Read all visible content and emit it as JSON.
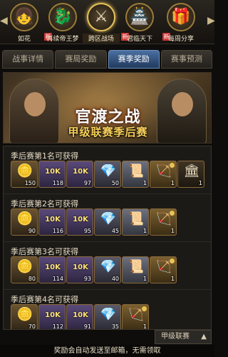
{
  "events": [
    {
      "label": "如花",
      "glyph": "👧",
      "new": false,
      "active": false
    },
    {
      "label": "再续帝王梦",
      "glyph": "🐉",
      "new": true,
      "active": false
    },
    {
      "label": "跨区战场",
      "glyph": "⚔",
      "new": false,
      "active": true
    },
    {
      "label": "君临天下",
      "glyph": "🏯",
      "new": true,
      "active": false
    },
    {
      "label": "每周分享",
      "glyph": "🎁",
      "new": true,
      "active": false
    }
  ],
  "new_badge": "新",
  "tabs": [
    "战事详情",
    "赛局奖励",
    "赛季奖励",
    "赛事预测"
  ],
  "active_tab": 2,
  "banner": {
    "title": "官渡之战",
    "subtitle": "甲级联赛季后赛"
  },
  "sections": [
    {
      "heading": "季后赛第1名可获得",
      "items": [
        {
          "type": "gold",
          "art": "🪙",
          "qty": "150"
        },
        {
          "type": "token",
          "art": "10K",
          "qty": "118"
        },
        {
          "type": "token",
          "art": "10K",
          "qty": "97"
        },
        {
          "type": "chest",
          "art": "💎",
          "qty": "50"
        },
        {
          "type": "scroll",
          "art": "📜",
          "qty": "1"
        },
        {
          "type": "troops",
          "art": "🏹",
          "qty": "1"
        },
        {
          "type": "banner-i",
          "art": "🏛",
          "qty": "1"
        }
      ]
    },
    {
      "heading": "季后赛第2名可获得",
      "items": [
        {
          "type": "gold",
          "art": "🪙",
          "qty": "90"
        },
        {
          "type": "token",
          "art": "10K",
          "qty": "116"
        },
        {
          "type": "token",
          "art": "10K",
          "qty": "95"
        },
        {
          "type": "chest",
          "art": "💎",
          "qty": "45"
        },
        {
          "type": "scroll",
          "art": "📜",
          "qty": "1"
        },
        {
          "type": "troops",
          "art": "🏹",
          "qty": "1"
        }
      ]
    },
    {
      "heading": "季后赛第3名可获得",
      "items": [
        {
          "type": "gold",
          "art": "🪙",
          "qty": "80"
        },
        {
          "type": "token",
          "art": "10K",
          "qty": "114"
        },
        {
          "type": "token",
          "art": "10K",
          "qty": "93"
        },
        {
          "type": "chest",
          "art": "💎",
          "qty": "40"
        },
        {
          "type": "scroll",
          "art": "📜",
          "qty": "1"
        },
        {
          "type": "troops",
          "art": "🏹",
          "qty": "1"
        }
      ]
    },
    {
      "heading": "季后赛第4名可获得",
      "items": [
        {
          "type": "gold",
          "art": "🪙",
          "qty": "70"
        },
        {
          "type": "token",
          "art": "10K",
          "qty": "112"
        },
        {
          "type": "token",
          "art": "10K",
          "qty": "91"
        },
        {
          "type": "chest",
          "art": "💎",
          "qty": "35"
        },
        {
          "type": "troops",
          "art": "🏹",
          "qty": "1"
        }
      ]
    }
  ],
  "league_tag": "甲级联赛",
  "footer": "奖励会自动发送至邮箱，无需领取"
}
